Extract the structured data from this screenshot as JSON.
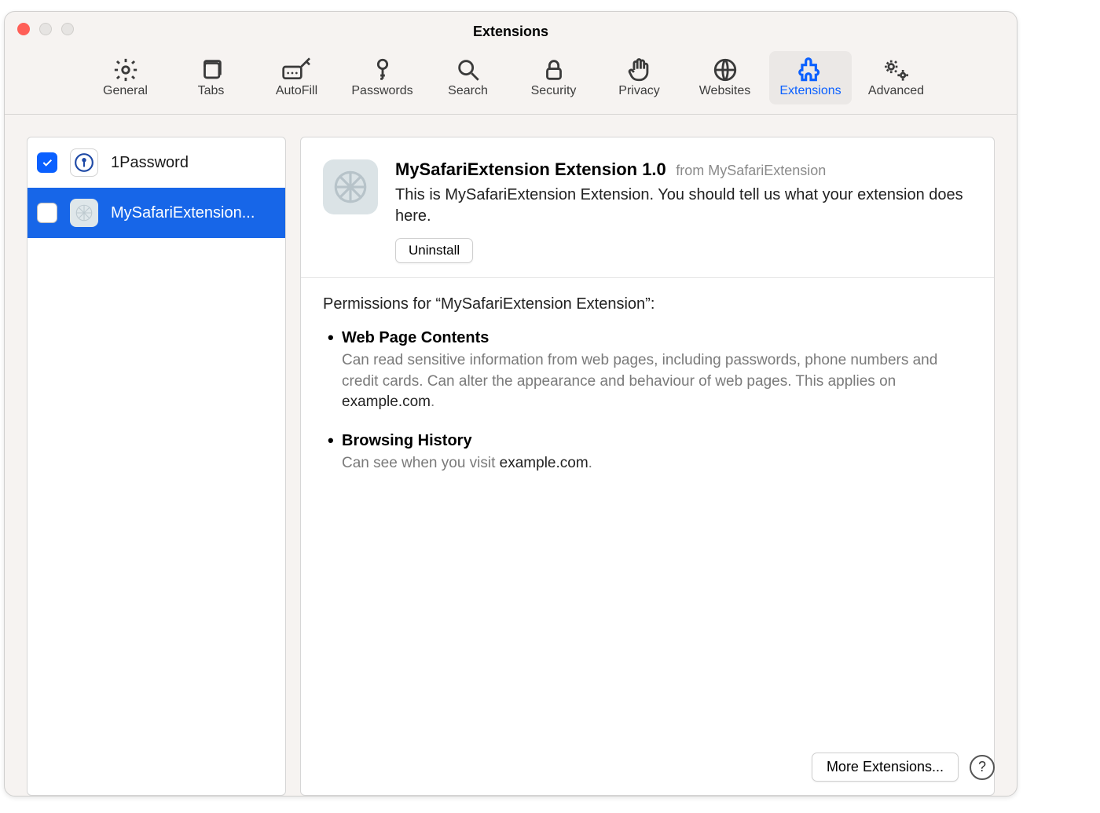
{
  "window": {
    "title": "Extensions"
  },
  "toolbar": {
    "items": [
      {
        "id": "general",
        "label": "General"
      },
      {
        "id": "tabs",
        "label": "Tabs"
      },
      {
        "id": "autofill",
        "label": "AutoFill"
      },
      {
        "id": "passwords",
        "label": "Passwords"
      },
      {
        "id": "search",
        "label": "Search"
      },
      {
        "id": "security",
        "label": "Security"
      },
      {
        "id": "privacy",
        "label": "Privacy"
      },
      {
        "id": "websites",
        "label": "Websites"
      },
      {
        "id": "extensions",
        "label": "Extensions"
      },
      {
        "id": "advanced",
        "label": "Advanced"
      }
    ],
    "active_id": "extensions"
  },
  "sidebar": {
    "items": [
      {
        "label": "1Password",
        "checked": true,
        "selected": false
      },
      {
        "label": "MySafariExtension...",
        "checked": false,
        "selected": true
      }
    ]
  },
  "detail": {
    "name": "MySafariExtension Extension 1.0",
    "from_label": "from MySafariExtension",
    "description": "This is MySafariExtension Extension. You should tell us what your extension does here.",
    "uninstall_label": "Uninstall"
  },
  "permissions": {
    "title": "Permissions for “MySafariExtension Extension”:",
    "items": [
      {
        "title": "Web Page Contents",
        "text_before": "Can read sensitive information from web pages, including passwords, phone numbers and credit cards. Can alter the appearance and behaviour of web pages. This applies on ",
        "domain": "example.com",
        "text_after": "."
      },
      {
        "title": "Browsing History",
        "text_before": "Can see when you visit ",
        "domain": "example.com",
        "text_after": "."
      }
    ]
  },
  "footer": {
    "more_label": "More Extensions...",
    "help_label": "?"
  }
}
